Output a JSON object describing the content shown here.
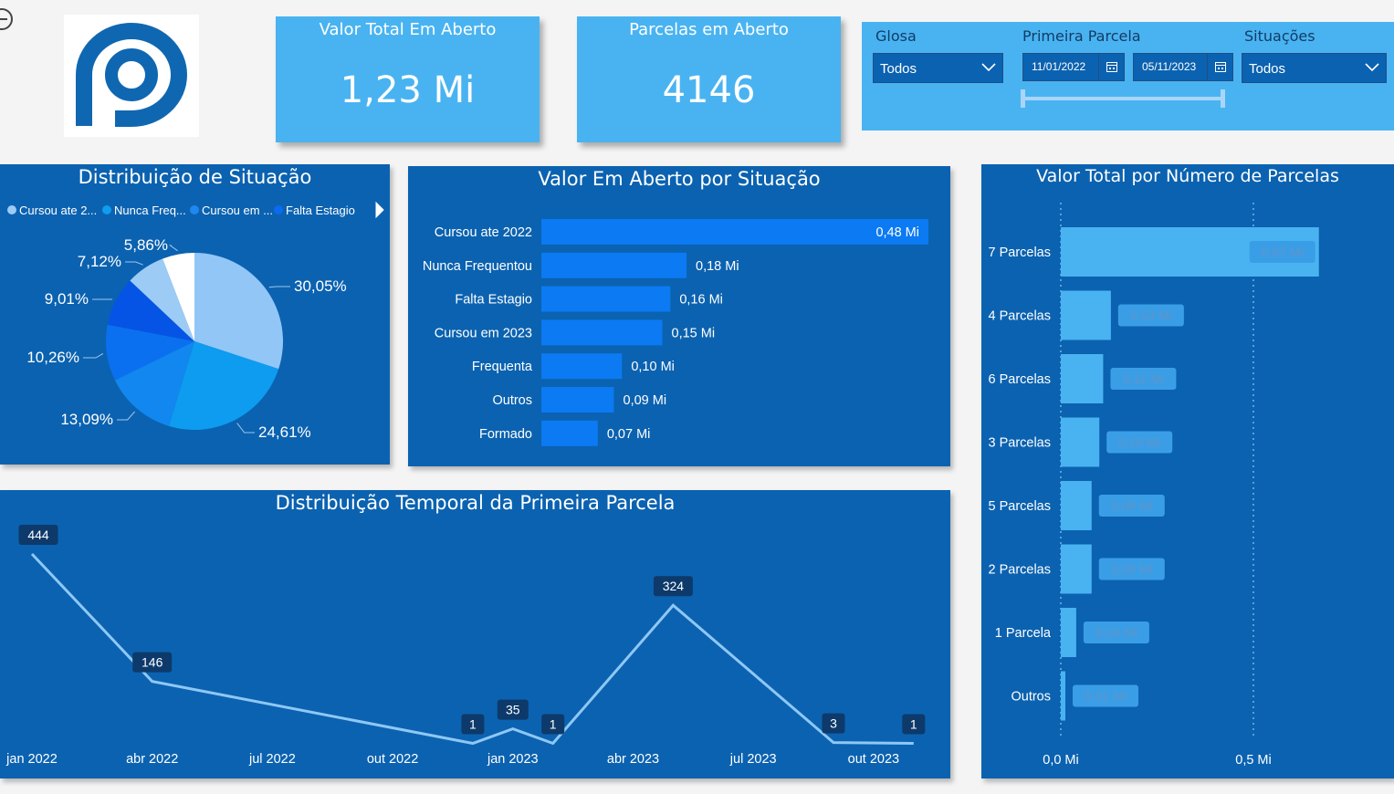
{
  "kpis": {
    "total_title": "Valor Total Em Aberto",
    "total_value": "1,23 Mi",
    "parcelas_title": "Parcelas em Aberto",
    "parcelas_value": "4146"
  },
  "filters": {
    "glosa_label": "Glosa",
    "glosa_value": "Todos",
    "primeira_label": "Primeira Parcela",
    "date_start": "11/01/2022",
    "date_end": "05/11/2023",
    "situacoes_label": "Situações",
    "situacoes_value": "Todos"
  },
  "colors": {
    "panel": "#0b62b0",
    "kpi": "#49b3f1",
    "bar_main": "#0b7af3",
    "bar_light": "#49b3f1",
    "line": "#8ec8f5"
  },
  "icons": {
    "collapse": "circle-minus-icon",
    "logo": "p-logo",
    "dropdown": "chevron-down-icon",
    "calendar": "calendar-icon",
    "legend_next": "triangle-right-icon"
  },
  "chart_data": [
    {
      "type": "pie",
      "title": "Distribuição de Situação",
      "legend": [
        "Cursou ate 2...",
        "Nunca Freq...",
        "Cursou em ...",
        "Falta Estagio"
      ],
      "legend_colors": [
        "#9ccbf5",
        "#0e9df0",
        "#1e88f0",
        "#0b6bf0"
      ],
      "values": [
        30.05,
        24.61,
        13.09,
        10.26,
        9.01,
        7.12,
        5.86
      ],
      "labels": [
        "30,05%",
        "24,61%",
        "13,09%",
        "10,26%",
        "9,01%",
        "7,12%",
        "5,86%"
      ],
      "colors": [
        "#92c6f7",
        "#0d9cf0",
        "#1287ef",
        "#0b70ef",
        "#0554e6",
        "#9ccbf5",
        "#ffffff"
      ]
    },
    {
      "type": "bar",
      "title": "Valor Em Aberto por Situação",
      "categories": [
        "Cursou ate 2022",
        "Nunca Frequentou",
        "Falta Estagio",
        "Cursou em 2023",
        "Frequenta",
        "Outros",
        "Formado"
      ],
      "values": [
        0.48,
        0.18,
        0.16,
        0.15,
        0.1,
        0.09,
        0.07
      ],
      "labels": [
        "0,48 Mi",
        "0,18 Mi",
        "0,16 Mi",
        "0,15 Mi",
        "0,10 Mi",
        "0,09 Mi",
        "0,07 Mi"
      ],
      "xlim": [
        0,
        0.48
      ]
    },
    {
      "type": "line",
      "title": "Distribuição Temporal da Primeira Parcela",
      "x": [
        "2022-01",
        "2022-04",
        "2022-12",
        "2023-01",
        "2023-02",
        "2023-05",
        "2023-09",
        "2023-11"
      ],
      "values": [
        444,
        146,
        1,
        35,
        1,
        324,
        3,
        1
      ],
      "x_ticks": [
        "jan 2022",
        "abr 2022",
        "jul 2022",
        "out 2022",
        "jan 2023",
        "abr 2023",
        "jul 2023",
        "out 2023"
      ],
      "ylim": [
        0,
        444
      ]
    },
    {
      "type": "bar",
      "title": "Valor Total por Número de Parcelas",
      "categories": [
        "7 Parcelas",
        "4 Parcelas",
        "6 Parcelas",
        "3 Parcelas",
        "5 Parcelas",
        "2 Parcelas",
        "1 Parcela",
        "Outros"
      ],
      "values": [
        0.67,
        0.13,
        0.11,
        0.1,
        0.08,
        0.08,
        0.04,
        0.01
      ],
      "labels": [
        "0,67 Mi",
        "0,13 Mi",
        "0,11 Mi",
        "0,10 Mi",
        "0,08 Mi",
        "0,08 Mi",
        "0,04 Mi",
        "0,01 Mi"
      ],
      "x_ticks": [
        "0,0 Mi",
        "0,5 Mi"
      ],
      "xlim": [
        0,
        0.72
      ]
    }
  ]
}
